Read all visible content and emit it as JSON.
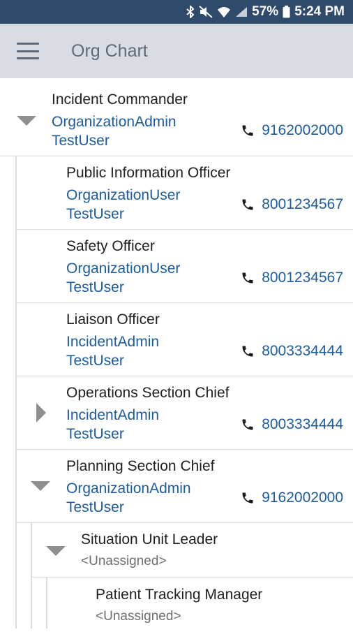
{
  "status_bar": {
    "battery": "57%",
    "time": "5:24 PM",
    "icons": [
      "bluetooth-icon",
      "mute-icon",
      "wifi-icon",
      "signal-icon",
      "battery-icon"
    ]
  },
  "app_bar": {
    "title": "Org Chart",
    "menu_icon": "hamburger-menu-icon"
  },
  "colors": {
    "status_bar": "#2f4a6b",
    "app_bar": "#d9dde3",
    "link": "#1c5c9e",
    "expander": "#8f8f8f"
  },
  "rows": [
    {
      "position": "Incident Commander",
      "name_line1": "OrganizationAdmin",
      "name_line2": "TestUser",
      "phone": "9162002000",
      "expander": "expanded"
    },
    {
      "position": "Public Information Officer",
      "name_line1": "OrganizationUser",
      "name_line2": "TestUser",
      "phone": "8001234567",
      "expander": "none"
    },
    {
      "position": "Safety Officer",
      "name_line1": "OrganizationUser",
      "name_line2": "TestUser",
      "phone": "8001234567",
      "expander": "none"
    },
    {
      "position": "Liaison Officer",
      "name_line1": "IncidentAdmin",
      "name_line2": "TestUser",
      "phone": "8003334444",
      "expander": "none"
    },
    {
      "position": "Operations Section Chief",
      "name_line1": "IncidentAdmin",
      "name_line2": "TestUser",
      "phone": "8003334444",
      "expander": "collapsed"
    },
    {
      "position": "Planning Section Chief",
      "name_line1": "OrganizationAdmin",
      "name_line2": "TestUser",
      "phone": "9162002000",
      "expander": "expanded"
    },
    {
      "position": "Situation Unit Leader",
      "assignee": "<Unassigned>",
      "expander": "expanded"
    },
    {
      "position": "Patient Tracking Manager",
      "assignee": "<Unassigned>",
      "expander": "none"
    }
  ]
}
